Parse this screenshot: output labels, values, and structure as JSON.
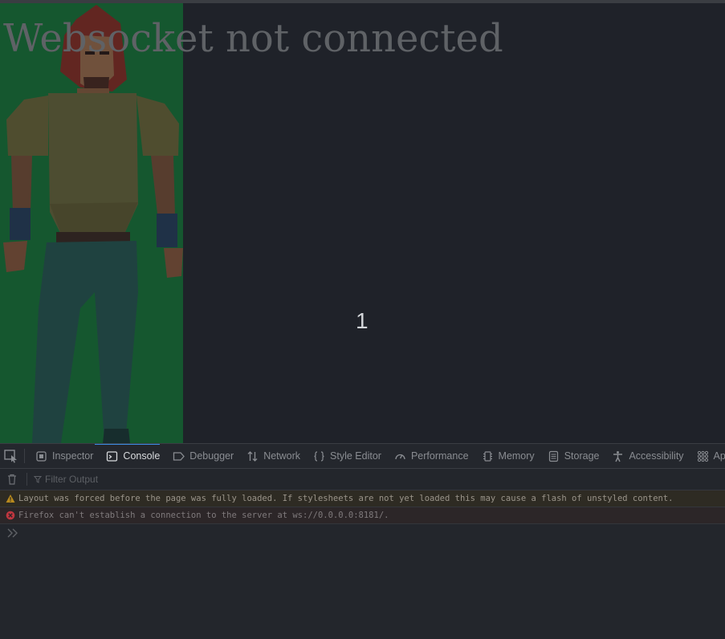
{
  "viewport": {
    "overlay_title": "Websocket not connected",
    "counter": "1"
  },
  "devtools": {
    "tabs": [
      {
        "label": "Inspector",
        "icon": "inspector-icon"
      },
      {
        "label": "Console",
        "icon": "console-icon",
        "active": true
      },
      {
        "label": "Debugger",
        "icon": "debugger-icon"
      },
      {
        "label": "Network",
        "icon": "network-icon"
      },
      {
        "label": "Style Editor",
        "icon": "style-editor-icon"
      },
      {
        "label": "Performance",
        "icon": "performance-icon"
      },
      {
        "label": "Memory",
        "icon": "memory-icon"
      },
      {
        "label": "Storage",
        "icon": "storage-icon"
      },
      {
        "label": "Accessibility",
        "icon": "accessibility-icon"
      },
      {
        "label": "Ap",
        "icon": "more-tools-icon"
      }
    ],
    "filter_placeholder": "Filter Output",
    "messages": [
      {
        "level": "warning",
        "text": "Layout was forced before the page was fully loaded. If stylesheets are not yet loaded this may cause a flash of unstyled content."
      },
      {
        "level": "error",
        "text": "Firefox can't establish a connection to the server at ws://0.0.0.0:8181/."
      }
    ]
  },
  "colors": {
    "game_background": "#157a3a",
    "page_background": "#1f2229",
    "active_tab_accent": "#3a8ee6",
    "warning_icon": "#b88a1e",
    "error_icon": "#c0363f"
  }
}
